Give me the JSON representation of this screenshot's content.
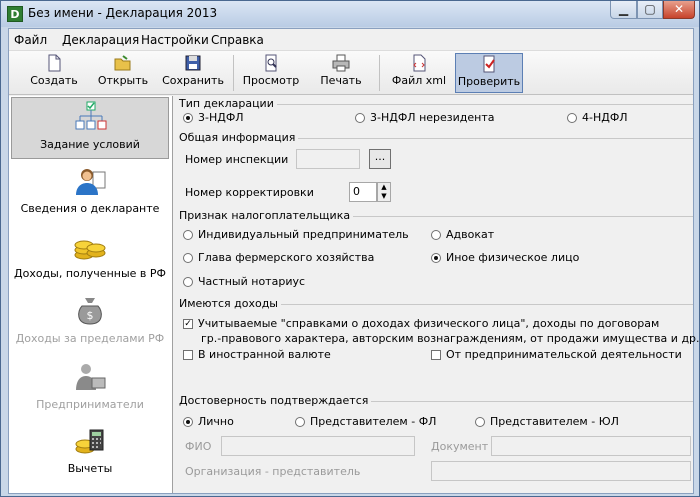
{
  "window": {
    "title": "Без имени - Декларация 2013",
    "app_icon": "D"
  },
  "menu": {
    "items": [
      "Файл",
      "Декларация",
      "Настройки",
      "Справка"
    ]
  },
  "toolbar": {
    "create": "Создать",
    "open": "Открыть",
    "save": "Сохранить",
    "preview": "Просмотр",
    "print": "Печать",
    "xml": "Файл xml",
    "check": "Проверить"
  },
  "sidebar": {
    "items": [
      "Задание условий",
      "Сведения о декларанте",
      "Доходы, полученные в РФ",
      "Доходы за пределами РФ",
      "Предприниматели",
      "Вычеты"
    ]
  },
  "decl_type": {
    "title": "Тип декларации",
    "options": [
      "3-НДФЛ",
      "3-НДФЛ нерезидента",
      "4-НДФЛ"
    ],
    "selected": "3-НДФЛ"
  },
  "general": {
    "title": "Общая информация",
    "inspection_label": "Номер инспекции",
    "inspection_value": "",
    "browse_label": "...",
    "correction_label": "Номер корректировки",
    "correction_value": "0"
  },
  "taxpayer": {
    "title": "Признак налогоплательщика",
    "options": [
      "Индивидуальный предприниматель",
      "Адвокат",
      "Глава фермерского хозяйства",
      "Иное физическое лицо",
      "Частный нотариус"
    ],
    "selected": "Иное физическое лицо"
  },
  "income": {
    "title": "Имеются доходы",
    "check1_line1": "Учитываемые \"справками о доходах физического лица\", доходы по договорам",
    "check1_line2": "гр.-правового характера, авторским вознаграждениям, от продажи имущества и др.",
    "check1": true,
    "check2": "В иностранной валюте",
    "check3": "От предпринимательской деятельности"
  },
  "confirm": {
    "title": "Достоверность подтверждается",
    "options": [
      "Лично",
      "Представителем - ФЛ",
      "Представителем - ЮЛ"
    ],
    "selected": "Лично",
    "fio_label": "ФИО",
    "doc_label": "Документ",
    "org_label": "Организация - представитель"
  }
}
